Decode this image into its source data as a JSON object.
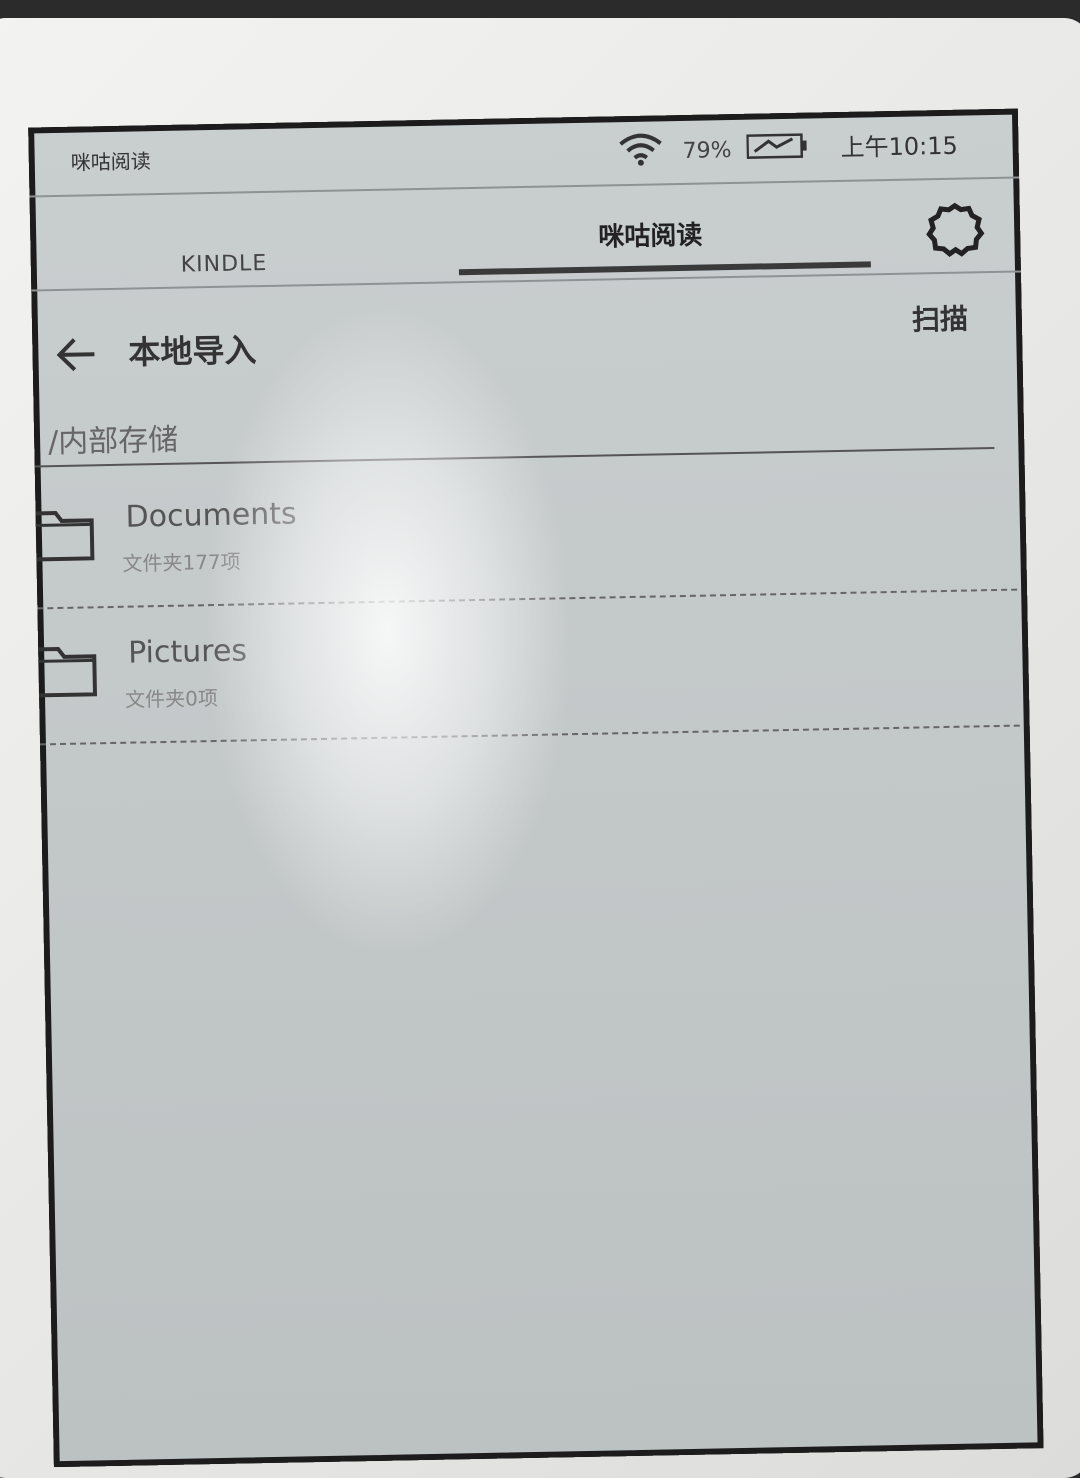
{
  "status_bar": {
    "app_label": "咪咕阅读",
    "battery": "79%",
    "time": "上午10:15"
  },
  "tabs": [
    {
      "label": "KINDLE"
    },
    {
      "label": "咪咕阅读"
    }
  ],
  "header": {
    "title": "本地导入",
    "scan_label": "扫描"
  },
  "path": "/内部存储",
  "files": [
    {
      "name": "Documents",
      "meta": "文件夹177项"
    },
    {
      "name": "Pictures",
      "meta": "文件夹0项"
    }
  ]
}
